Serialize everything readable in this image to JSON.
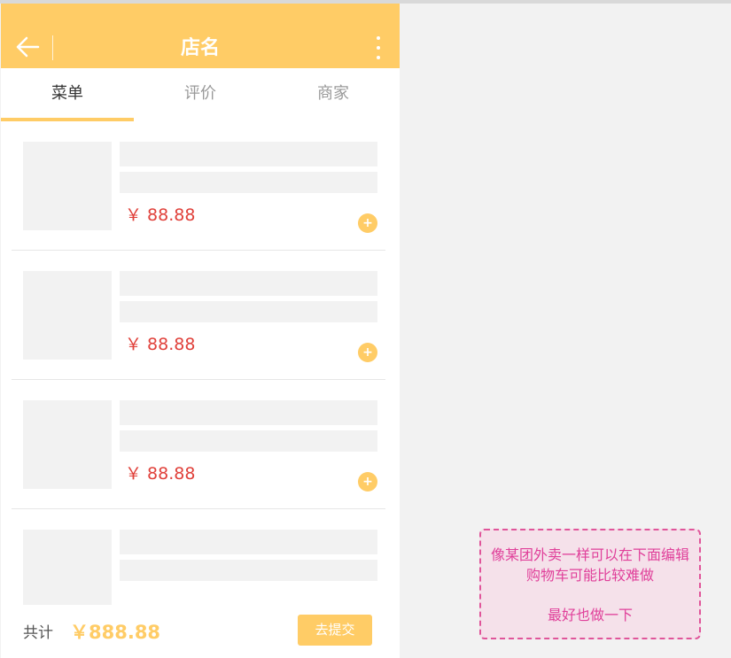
{
  "header": {
    "title": "店名",
    "back_icon": "arrow-left-icon",
    "more_icon": "more-vertical-icon"
  },
  "tabs": [
    {
      "label": "菜单",
      "active": true
    },
    {
      "label": "评价",
      "active": false
    },
    {
      "label": "商家",
      "active": false
    }
  ],
  "menu_items": [
    {
      "price": "￥ 88.88",
      "add_label": "+"
    },
    {
      "price": "￥ 88.88",
      "add_label": "+"
    },
    {
      "price": "￥ 88.88",
      "add_label": "+"
    },
    {
      "price": "",
      "add_label": ""
    }
  ],
  "footer": {
    "total_label": "共计",
    "total_price": "￥888.88",
    "submit_label": "去提交"
  },
  "note": {
    "line1": "像某团外卖一样可以在下面编辑",
    "line2": "购物车可能比较难做",
    "line3": "最好也做一下"
  },
  "colors": {
    "accent": "#ffcc66",
    "price": "#e0403a",
    "note_border": "#e0559a",
    "note_bg": "#f5e1ea"
  }
}
